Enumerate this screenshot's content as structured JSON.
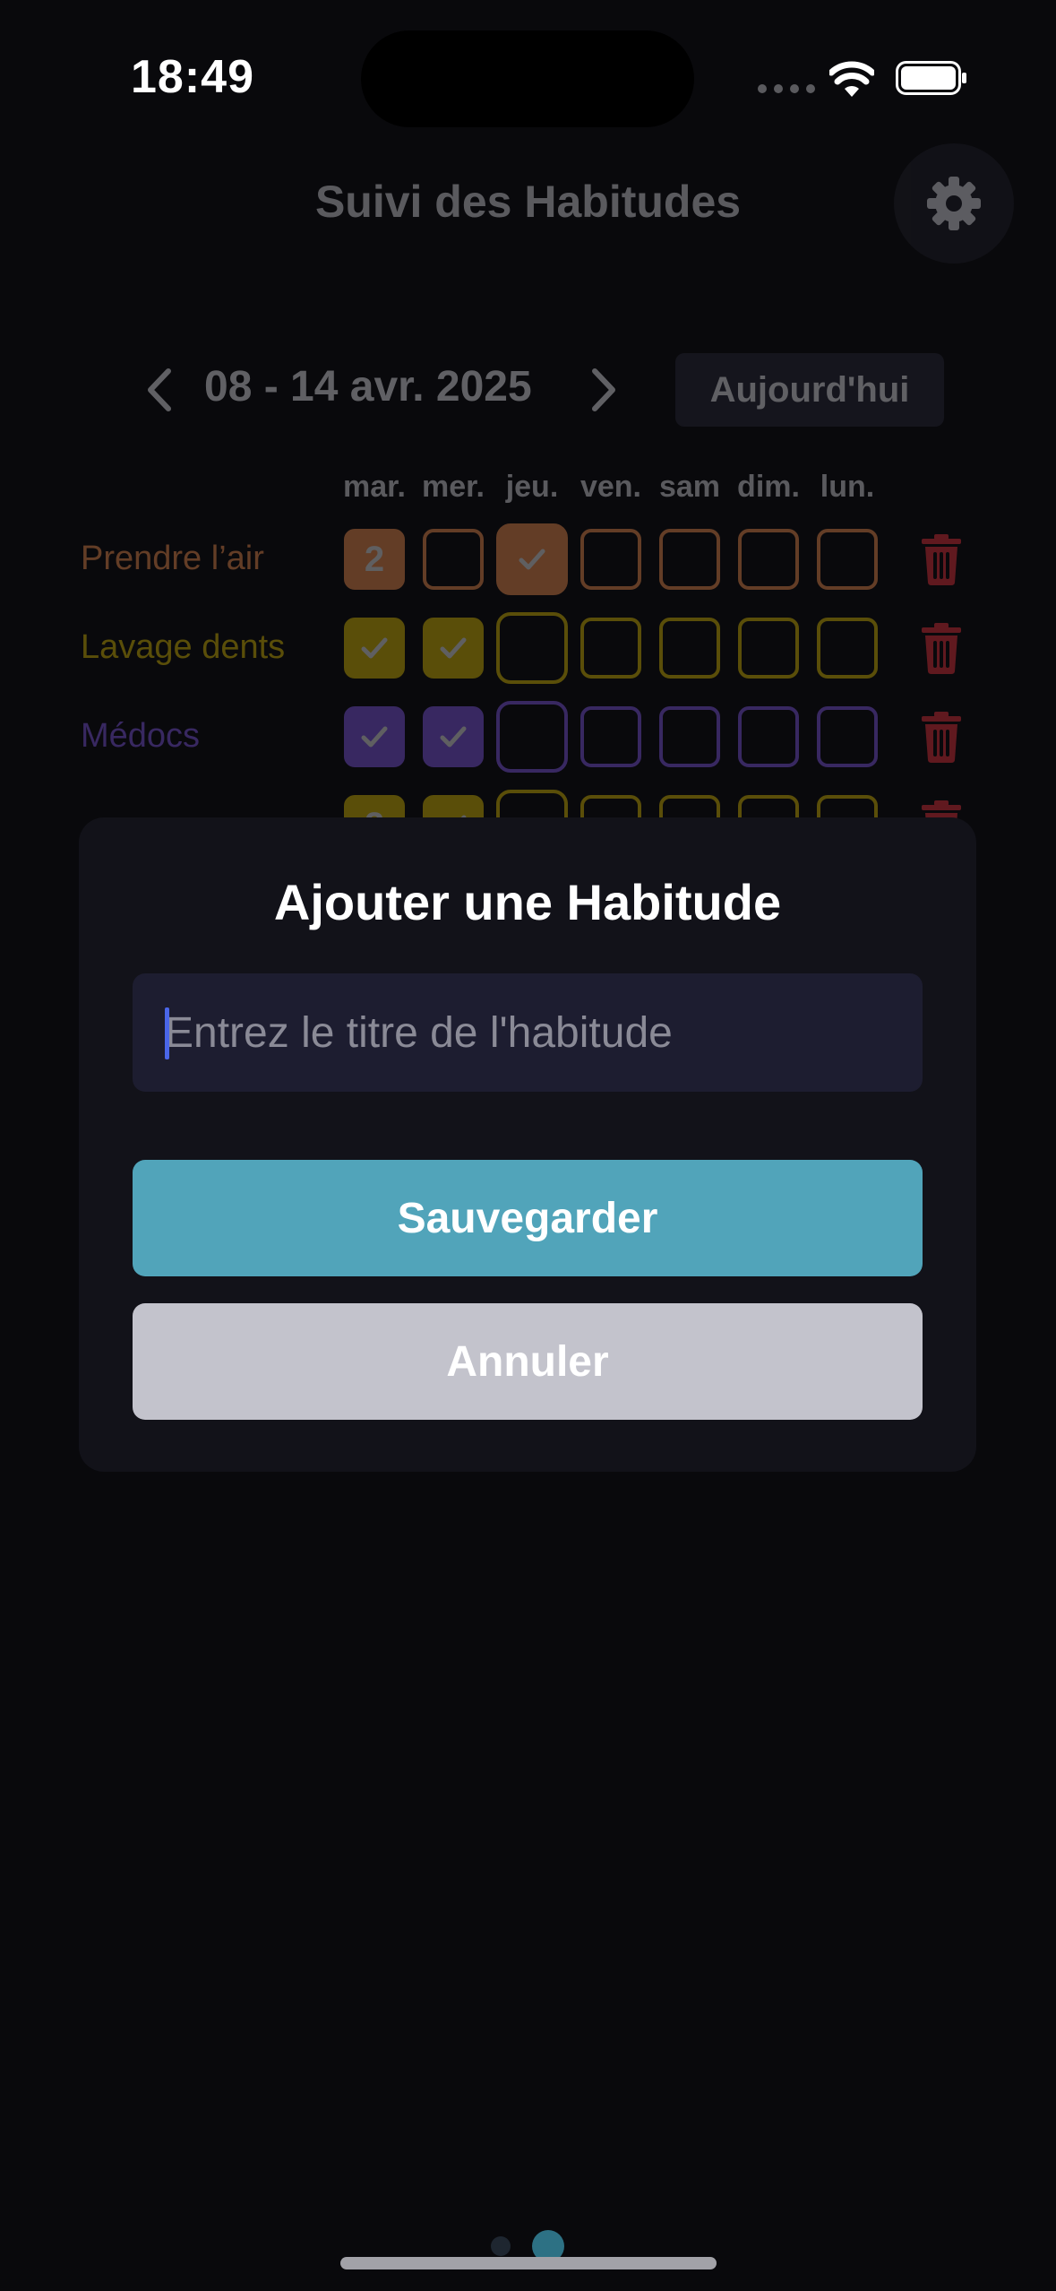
{
  "status_bar": {
    "time": "18:49"
  },
  "header": {
    "title": "Suivi des Habitudes",
    "settings_icon": "gear-icon"
  },
  "week_nav": {
    "label": "08 - 14 avr. 2025",
    "today_button": "Aujourd'hui"
  },
  "days": [
    "mar.",
    "mer.",
    "jeu.",
    "ven.",
    "sam",
    "dim.",
    "lun."
  ],
  "habits": [
    {
      "name": "Prendre l’air",
      "color": "#e0864a",
      "cells": [
        "2",
        "empty",
        "check",
        "empty",
        "empty",
        "empty",
        "empty"
      ]
    },
    {
      "name": "Lavage dents",
      "color": "#c9ad06",
      "cells": [
        "check",
        "check",
        "empty",
        "empty",
        "empty",
        "empty",
        "empty"
      ]
    },
    {
      "name": "Médocs",
      "color": "#7a54d6",
      "cells": [
        "check",
        "check",
        "empty",
        "empty",
        "empty",
        "empty",
        "empty"
      ]
    },
    {
      "name": "",
      "color": "#c9ad06",
      "cells": [
        "2",
        "check",
        "empty",
        "empty",
        "empty",
        "empty",
        "empty"
      ]
    }
  ],
  "today_index": 2,
  "colors": {
    "delete": "#d9313a",
    "save": "#51a4ba",
    "cancel": "#c3c3cc",
    "accent_caret": "#4a66e8"
  },
  "modal": {
    "title": "Ajouter une Habitude",
    "input_value": "",
    "input_placeholder": "Entrez le titre de l'habitude",
    "save_label": "Sauvegarder",
    "cancel_label": "Annuler"
  },
  "pager": {
    "pages": 2,
    "current": 2
  }
}
